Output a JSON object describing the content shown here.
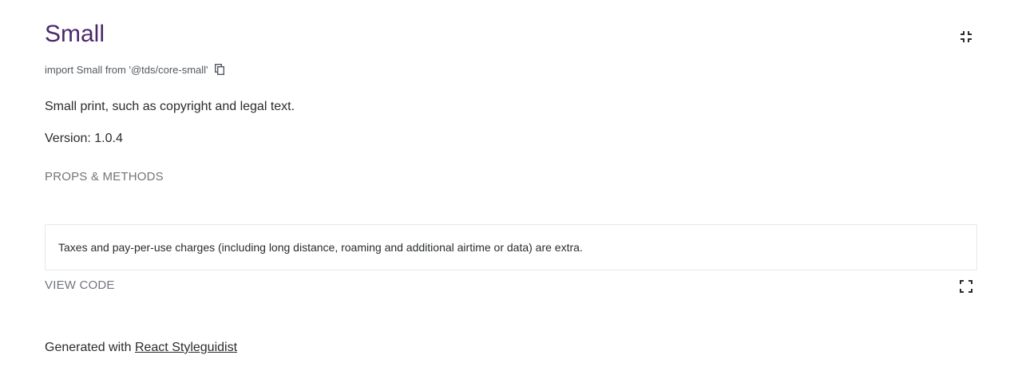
{
  "component": {
    "title": "Small",
    "import_statement": "import Small from '@tds/core-small'",
    "description": "Small print, such as copyright and legal text.",
    "version": "Version: 1.0.4"
  },
  "links": {
    "props_methods": "PROPS & METHODS",
    "view_code": "VIEW CODE"
  },
  "preview": {
    "text": "Taxes and pay-per-use charges (including long distance, roaming and additional airtime or data) are extra."
  },
  "footer": {
    "prefix": "Generated with ",
    "link_label": "React Styleguidist"
  },
  "icons": {
    "collapse": "fullscreen-exit-icon",
    "copy": "copy-icon",
    "expand": "fullscreen-icon"
  },
  "colors": {
    "title": "#4b286d",
    "muted": "#71757b",
    "text": "#2a2c2e",
    "border": "#e8e8e8"
  }
}
